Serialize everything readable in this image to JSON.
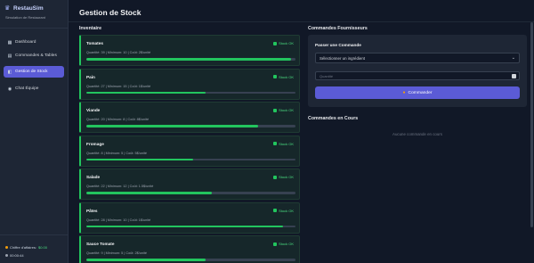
{
  "sidebar": {
    "brand_icon": "chef-hat-icon",
    "brand_title": "RestauSim",
    "brand_subtitle": "Simulation de Restaurant",
    "items": [
      {
        "label": "Dashboard",
        "icon": "dashboard-icon",
        "glyph": "▦",
        "active": false
      },
      {
        "label": "Commandes & Tables",
        "icon": "clipboard-icon",
        "glyph": "▤",
        "active": false
      },
      {
        "label": "Gestion de Stock",
        "icon": "box-icon",
        "glyph": "◧",
        "active": true
      },
      {
        "label": "Chat Équipe",
        "icon": "chat-icon",
        "glyph": "◉",
        "active": false
      }
    ],
    "revenue_label": "Chiffre d'affaires:",
    "revenue_value": "$0.00",
    "clock": "00:00:44"
  },
  "page_title": "Gestion de Stock",
  "inventory": {
    "title": "Inventaire",
    "items": [
      {
        "name": "Tomates",
        "badge": "Stock OK",
        "info": "Quantité: 39 | Minimum: 10 | Coût: 2$/unité",
        "level": 0.98
      },
      {
        "name": "Pain",
        "badge": "Stock OK",
        "info": "Quantité: 27 | Minimum: 15 | Coût: 1$/unité",
        "level": 0.57
      },
      {
        "name": "Viande",
        "badge": "Stock OK",
        "info": "Quantité: 20 | Minimum: 8 | Coût: 8$/unité",
        "level": 0.82
      },
      {
        "name": "Fromage",
        "badge": "Stock OK",
        "info": "Quantité: 8 | Minimum: 5 | Coût: 5$/unité",
        "level": 0.51
      },
      {
        "name": "Salade",
        "badge": "Stock OK",
        "info": "Quantité: 22 | Minimum: 12 | Coût: 1.5$/unité",
        "level": 0.6
      },
      {
        "name": "Pâtes",
        "badge": "Stock OK",
        "info": "Quantité: 28 | Minimum: 10 | Coût: 1$/unité",
        "level": 0.94
      },
      {
        "name": "Sauce Tomate",
        "badge": "Stock OK",
        "info": "Quantité: 9 | Minimum: 5 | Coût: 2$/unité",
        "level": 0.57
      }
    ]
  },
  "suppliers": {
    "title": "Commandes Fournisseurs",
    "form_title": "Passer une Commande",
    "select_value": "Sélectionner un ingrédient",
    "qty_placeholder": "Quantité",
    "button_label": "Commander",
    "button_icon": "cart-icon"
  },
  "current_orders": {
    "title": "Commandes en Cours",
    "empty": "Aucune commande en cours"
  },
  "colors": {
    "accent": "#5b5bd6",
    "ok": "#22c55e",
    "background": "#111827"
  }
}
